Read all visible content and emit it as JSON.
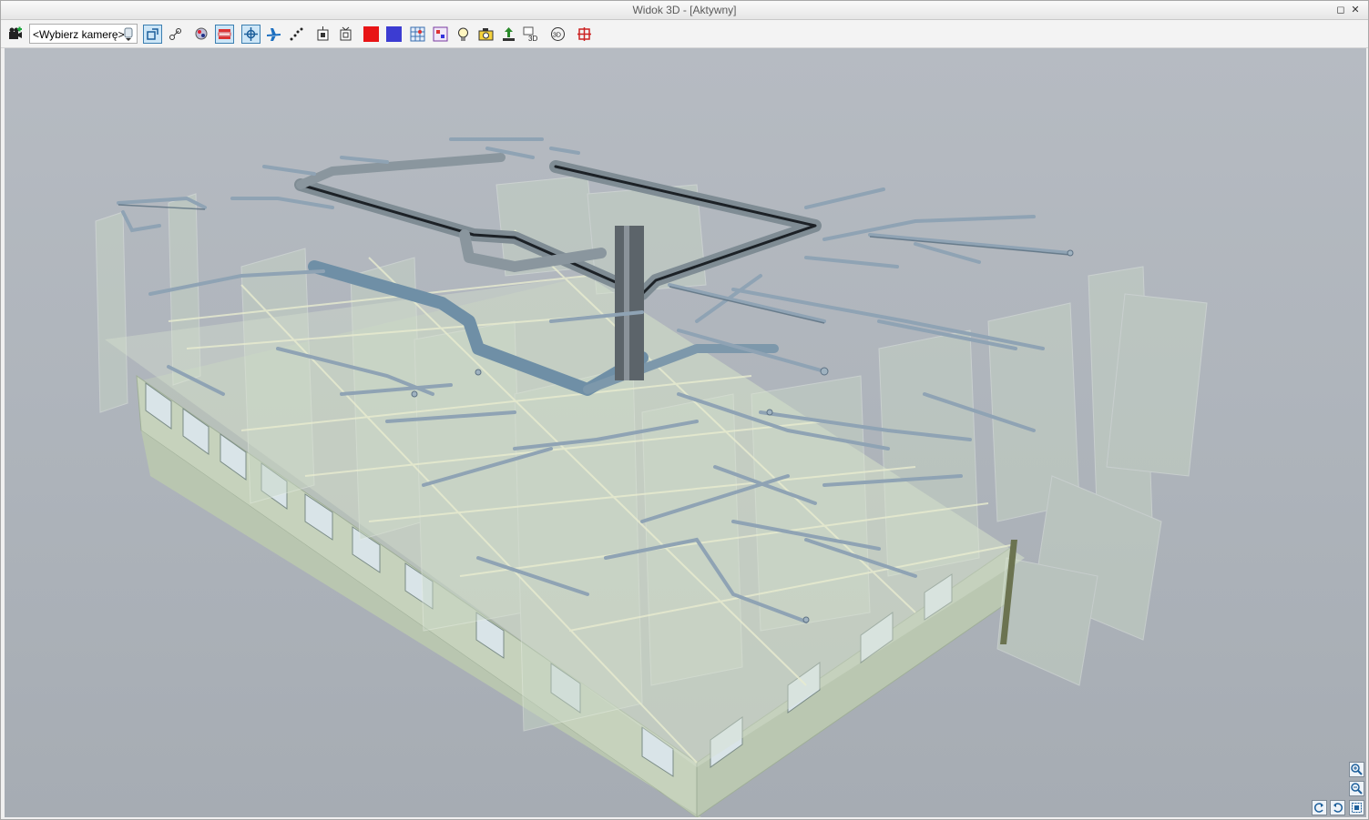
{
  "window": {
    "title": "Widok 3D - [Aktywny]",
    "restore_glyph": "◻",
    "close_glyph": "✕"
  },
  "toolbar": {
    "camera_select": {
      "value": "<Wybierz kamerę>"
    },
    "colors": {
      "red": "#e81416",
      "blue": "#3c3cd2",
      "accent": "#3c7fb1"
    },
    "icons": [
      "add-camera-icon",
      "camera-dropdown-icon",
      "perspective-icon",
      "axonometric-icon",
      "render-style-icon",
      "layers-icon",
      "orbit-icon",
      "fly-icon",
      "walk-icon",
      "section-icon",
      "section-box-icon",
      "red-color-icon",
      "blue-color-icon",
      "grid-icon",
      "legend-icon",
      "light-icon",
      "camera-icon",
      "level-icon",
      "view-3d-icon",
      "rotate-3d-icon",
      "clipping-icon"
    ]
  },
  "viewport": {
    "background": "#aeb4bb",
    "navigation": [
      "zoom-in-icon",
      "zoom-out-icon",
      "rotate-left-icon",
      "rotate-right-icon",
      "zoom-extents-icon"
    ]
  }
}
